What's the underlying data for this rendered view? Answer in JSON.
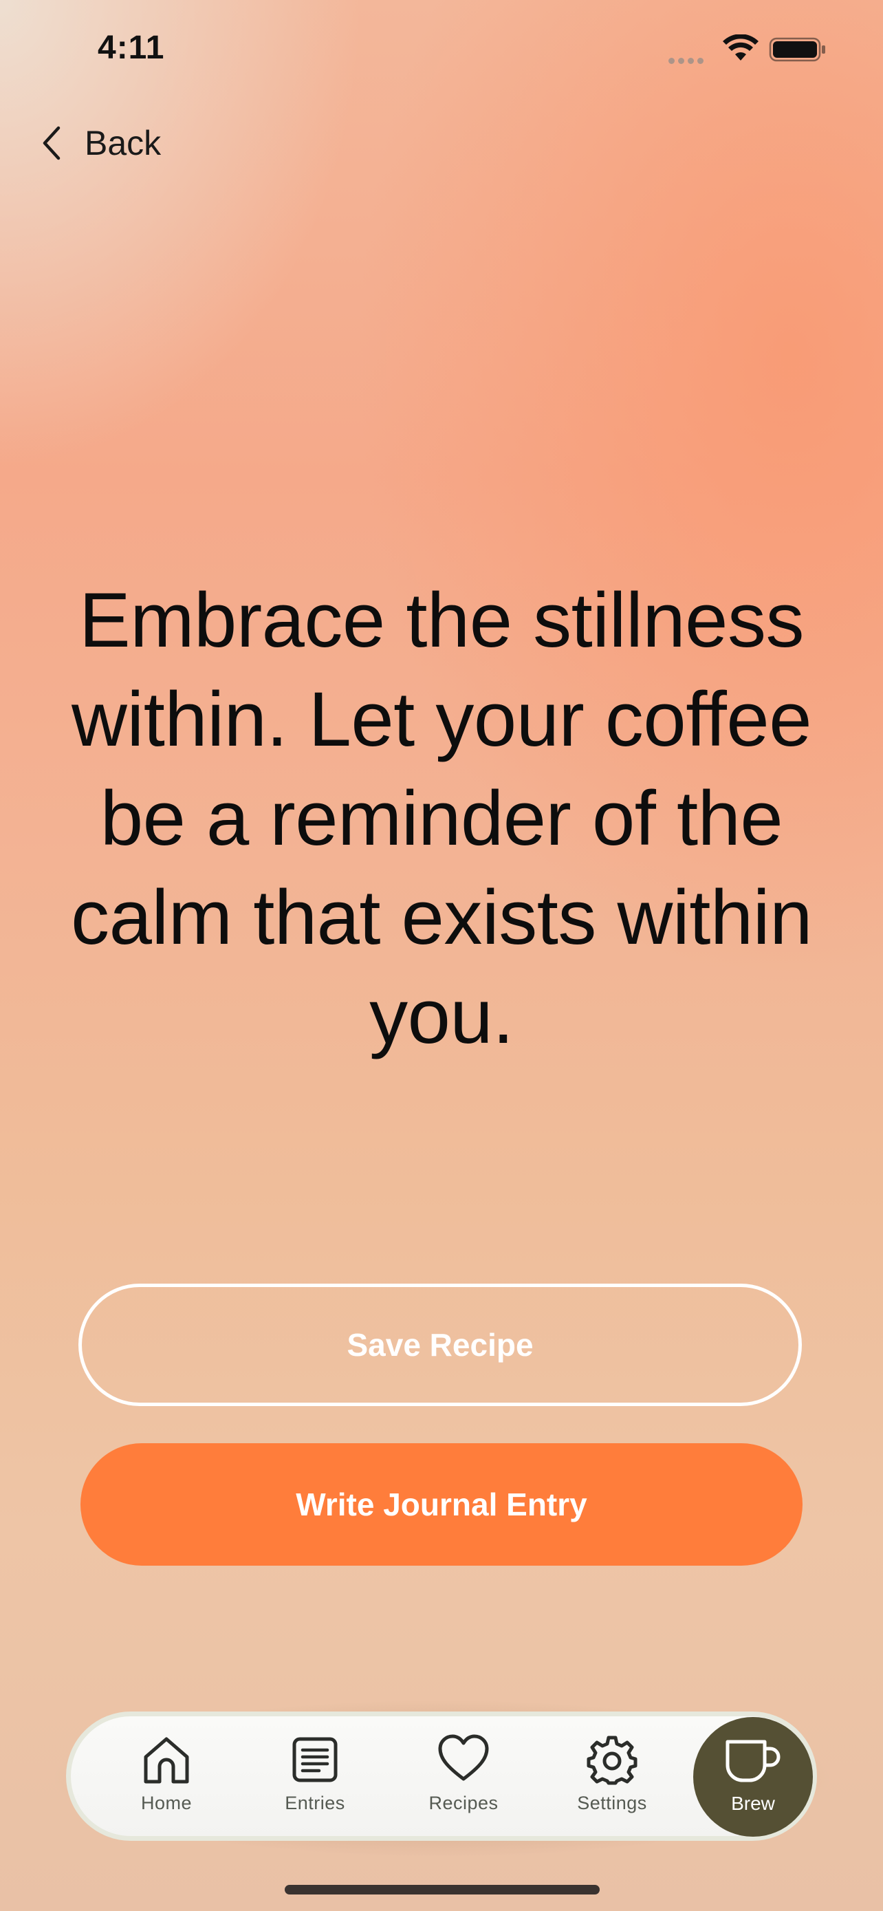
{
  "status_bar": {
    "time": "4:11"
  },
  "nav": {
    "back_label": "Back"
  },
  "quote": {
    "text": "Embrace the stillness within. Let your coffee be a reminder of the calm that exists within you."
  },
  "actions": {
    "save_label": "Save Recipe",
    "journal_label": "Write Journal Entry"
  },
  "tab_bar": {
    "home_label": "Home",
    "entries_label": "Entries",
    "recipes_label": "Recipes",
    "settings_label": "Settings",
    "brew_label": "Brew"
  },
  "colors": {
    "accent_orange": "#ff7d3b",
    "brew_olive": "#555034"
  }
}
